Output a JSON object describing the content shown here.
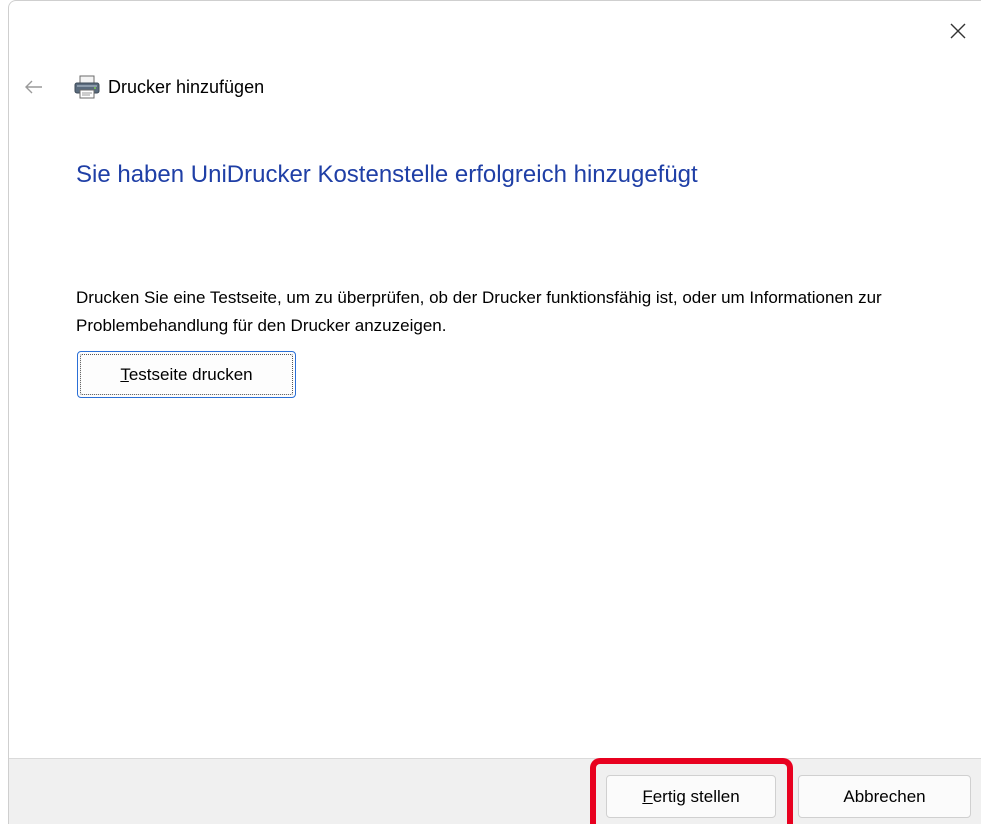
{
  "window": {
    "title": "Drucker hinzufügen",
    "close_icon": "close-icon",
    "back_icon": "back-arrow-icon",
    "printer_icon": "printer-icon"
  },
  "main": {
    "heading": "Sie haben UniDrucker Kostenstelle erfolgreich hinzugefügt",
    "description": "Drucken Sie eine Testseite, um zu überprüfen, ob der Drucker funktionsfähig ist, oder um Informationen zur Problembehandlung für den Drucker anzuzeigen.",
    "test_page_button": "Testseite drucken"
  },
  "footer": {
    "finish_button": "Fertig stellen",
    "cancel_button": "Abbrechen"
  },
  "colors": {
    "heading": "#1f3fa6",
    "highlight": "#e8001f",
    "footer_bg": "#f0f0f0"
  }
}
